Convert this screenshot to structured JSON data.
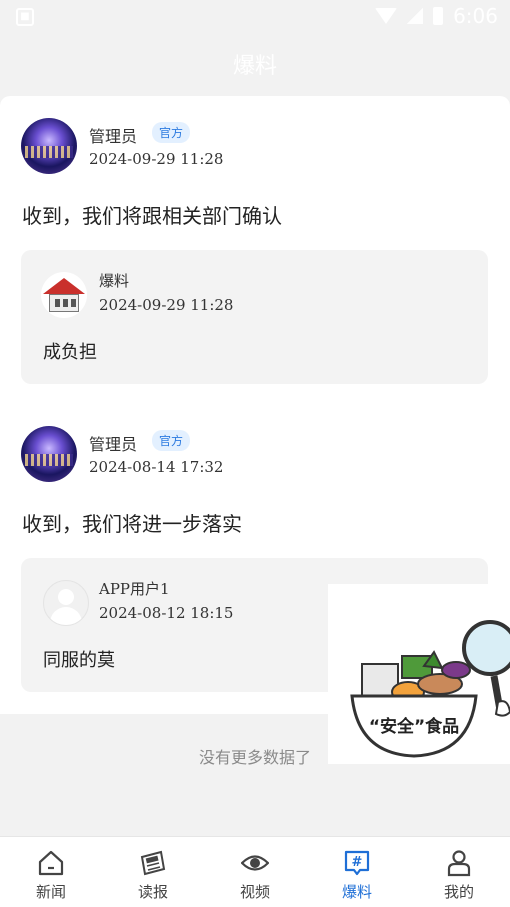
{
  "status_bar": {
    "time": "6:06"
  },
  "header": {
    "title": "爆料"
  },
  "posts": [
    {
      "author": "管理员",
      "badge": "官方",
      "time": "2024-09-29  11:28",
      "content": "收到，我们将跟相关部门确认",
      "quote": {
        "author": "爆料",
        "time": "2024-09-29  11:28",
        "text": "成负担"
      }
    },
    {
      "author": "管理员",
      "badge": "官方",
      "time": "2024-08-14  17:32",
      "content": "收到，我们将进一步落实",
      "quote": {
        "author": "APP用户1",
        "time": "2024-08-12  18:15",
        "text": "同服的莫"
      }
    }
  ],
  "footer_text": "没有更多数据了",
  "floating_image": {
    "caption": "“安全”食品"
  },
  "tabs": [
    {
      "label": "新闻",
      "icon": "home-icon"
    },
    {
      "label": "读报",
      "icon": "newspaper-icon"
    },
    {
      "label": "视频",
      "icon": "eye-icon"
    },
    {
      "label": "爆料",
      "icon": "hashtag-icon",
      "active": true
    },
    {
      "label": "我的",
      "icon": "user-icon"
    }
  ],
  "colors": {
    "accent": "#1f6fd6",
    "badge_bg": "#e3f0ff",
    "badge_text": "#2d7be0"
  }
}
